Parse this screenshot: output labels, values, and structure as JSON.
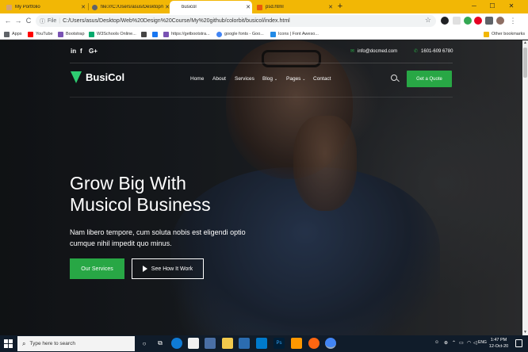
{
  "browser": {
    "tabs": [
      {
        "label": "My Portfolio",
        "favicon_color": "#d4a373",
        "active": false
      },
      {
        "label": "file:///C:/Users/asus/Desktop/W...",
        "favicon_color": "#5f6368",
        "active": false
      },
      {
        "label": "busicol",
        "favicon_color": "#ffffff",
        "active": true
      },
      {
        "label": "psd.html",
        "favicon_color": "#e8590c",
        "active": false
      }
    ],
    "new_tab": "+",
    "window_controls": {
      "minimize": "─",
      "maximize": "☐",
      "close": "✕"
    },
    "nav": {
      "back": "←",
      "forward": "→",
      "reload": "C"
    },
    "address": {
      "scheme_label": "File",
      "url": "C:/Users/asus/Desktop/Web%20Design%20Course/My%20github/colorbit/busicol/index.html"
    },
    "bookmarks": [
      {
        "label": "Apps",
        "icon_color": "#5f6368"
      },
      {
        "label": "YouTube",
        "icon_color": "#ff0000"
      },
      {
        "label": "Bootstrap",
        "icon_color": "#7952b3"
      },
      {
        "label": "W3Schools Online...",
        "icon_color": "#04aa6d"
      },
      {
        "label": "",
        "icon_color": "#444"
      },
      {
        "label": "",
        "icon_color": "#1877f2"
      },
      {
        "label": "https://getbootstra...",
        "icon_color": "#7952b3"
      },
      {
        "label": "google fonts - Goo...",
        "icon_color": "#4285f4"
      },
      {
        "label": "Icons | Font Aweso...",
        "icon_color": "#228ae6"
      }
    ],
    "other_bookmarks": "Other bookmarks"
  },
  "site": {
    "social": [
      "in",
      "f",
      "G+"
    ],
    "email": "info@docmed.com",
    "phone": "1601-609 6780",
    "logo_text": "BusiCol",
    "nav": [
      {
        "label": "Home",
        "has_dropdown": false
      },
      {
        "label": "About",
        "has_dropdown": false
      },
      {
        "label": "Services",
        "has_dropdown": false
      },
      {
        "label": "Blog",
        "has_dropdown": true
      },
      {
        "label": "Pages",
        "has_dropdown": true
      },
      {
        "label": "Contact",
        "has_dropdown": false
      }
    ],
    "dropdown_caret": "⌄",
    "quote_button": "Get a Quote",
    "hero": {
      "title_line1": "Grow Big With",
      "title_line2": "Musicol Business",
      "subtitle_line1": "Nam libero tempore, cum soluta nobis est eligendi optio",
      "subtitle_line2": "cumque nihil impedit quo minus.",
      "primary_button": "Our Services",
      "secondary_button": "See How It Work"
    },
    "accent_color": "#28a745"
  },
  "taskbar": {
    "search_placeholder": "Type here to search",
    "clock_time": "1:47 PM",
    "clock_date": "12-Oct-20",
    "language": "ENG"
  }
}
